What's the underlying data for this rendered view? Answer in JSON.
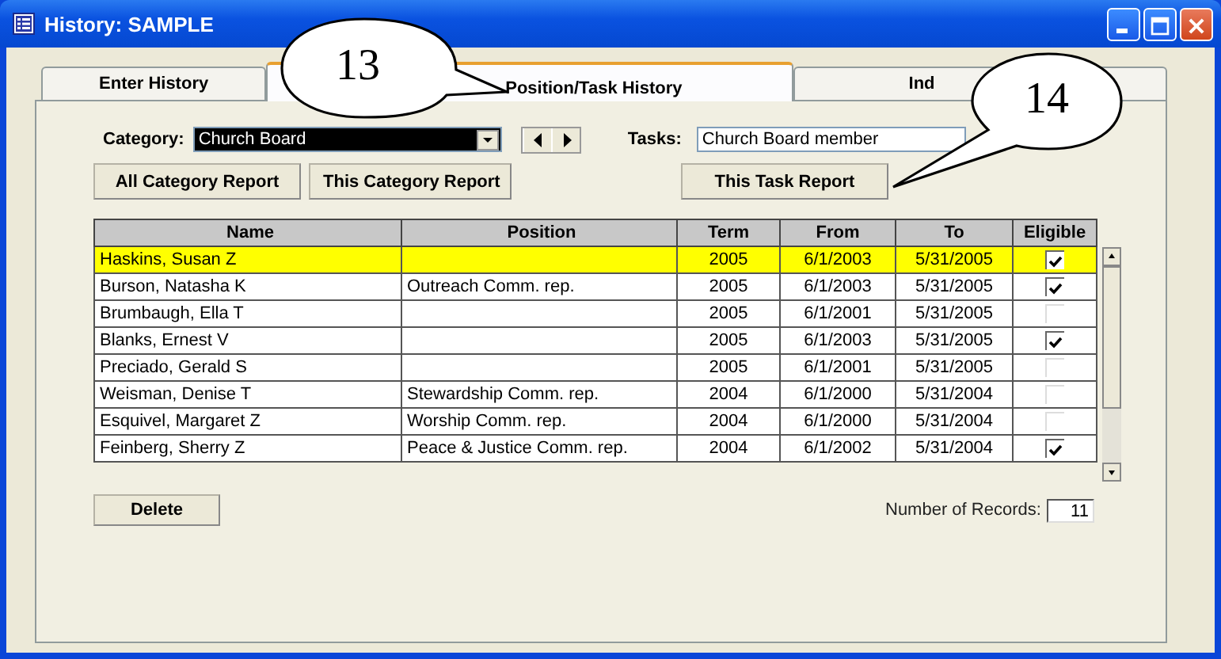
{
  "window": {
    "title": "History: SAMPLE"
  },
  "tabs": [
    {
      "label": "Enter History",
      "selected": false
    },
    {
      "label": "Position/Task History",
      "selected": true
    },
    {
      "label": "Ind",
      "selected": false
    }
  ],
  "callouts": [
    {
      "label": "13"
    },
    {
      "label": "14"
    }
  ],
  "category": {
    "label": "Category:",
    "value": "Church Board"
  },
  "tasks": {
    "label": "Tasks:",
    "value": "Church Board member"
  },
  "report_buttons": [
    "All Category Report",
    "This Category Report",
    "This Task Report"
  ],
  "table": {
    "columns": [
      "Name",
      "Position",
      "Term",
      "From",
      "To",
      "Eligible"
    ],
    "rows": [
      {
        "name": "Haskins, Susan Z",
        "position": "",
        "term": "2005",
        "from": "6/1/2003",
        "to": "5/31/2005",
        "eligible": true,
        "selected": true
      },
      {
        "name": "Burson, Natasha K",
        "position": "Outreach Comm. rep.",
        "term": "2005",
        "from": "6/1/2003",
        "to": "5/31/2005",
        "eligible": true,
        "selected": false
      },
      {
        "name": "Brumbaugh, Ella T",
        "position": "",
        "term": "2005",
        "from": "6/1/2001",
        "to": "5/31/2005",
        "eligible": false,
        "selected": false
      },
      {
        "name": "Blanks, Ernest V",
        "position": "",
        "term": "2005",
        "from": "6/1/2003",
        "to": "5/31/2005",
        "eligible": true,
        "selected": false
      },
      {
        "name": "Preciado, Gerald S",
        "position": "",
        "term": "2005",
        "from": "6/1/2001",
        "to": "5/31/2005",
        "eligible": false,
        "selected": false
      },
      {
        "name": "Weisman, Denise T",
        "position": "Stewardship Comm. rep.",
        "term": "2004",
        "from": "6/1/2000",
        "to": "5/31/2004",
        "eligible": false,
        "selected": false
      },
      {
        "name": "Esquivel, Margaret Z",
        "position": "Worship Comm. rep.",
        "term": "2004",
        "from": "6/1/2000",
        "to": "5/31/2004",
        "eligible": false,
        "selected": false
      },
      {
        "name": "Feinberg, Sherry Z",
        "position": "Peace & Justice Comm. rep.",
        "term": "2004",
        "from": "6/1/2002",
        "to": "5/31/2004",
        "eligible": true,
        "selected": false
      }
    ]
  },
  "delete_button": "Delete",
  "records": {
    "label": "Number of Records:",
    "value": "11"
  }
}
